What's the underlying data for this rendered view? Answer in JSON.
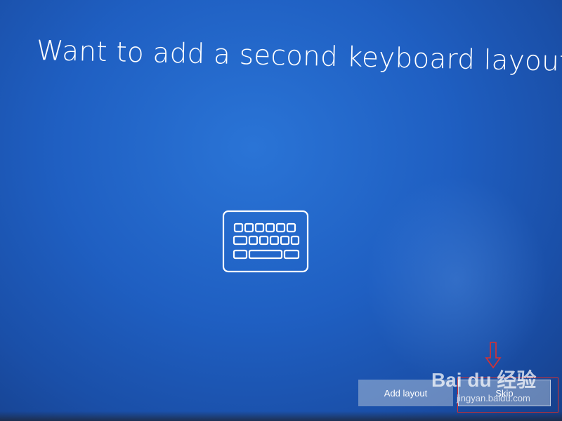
{
  "screen": {
    "title": "Want to add a second keyboard layout?",
    "background_color": "#1f5fc2",
    "icon": "keyboard-icon"
  },
  "actions": {
    "add_layout_label": "Add layout",
    "skip_label": "Skip"
  },
  "watermark": {
    "brand": "Bai du 经验",
    "url": "jingyan.baidu.com"
  },
  "annotation": {
    "color": "#d93030",
    "arrow_icon": "down-arrow-icon"
  }
}
